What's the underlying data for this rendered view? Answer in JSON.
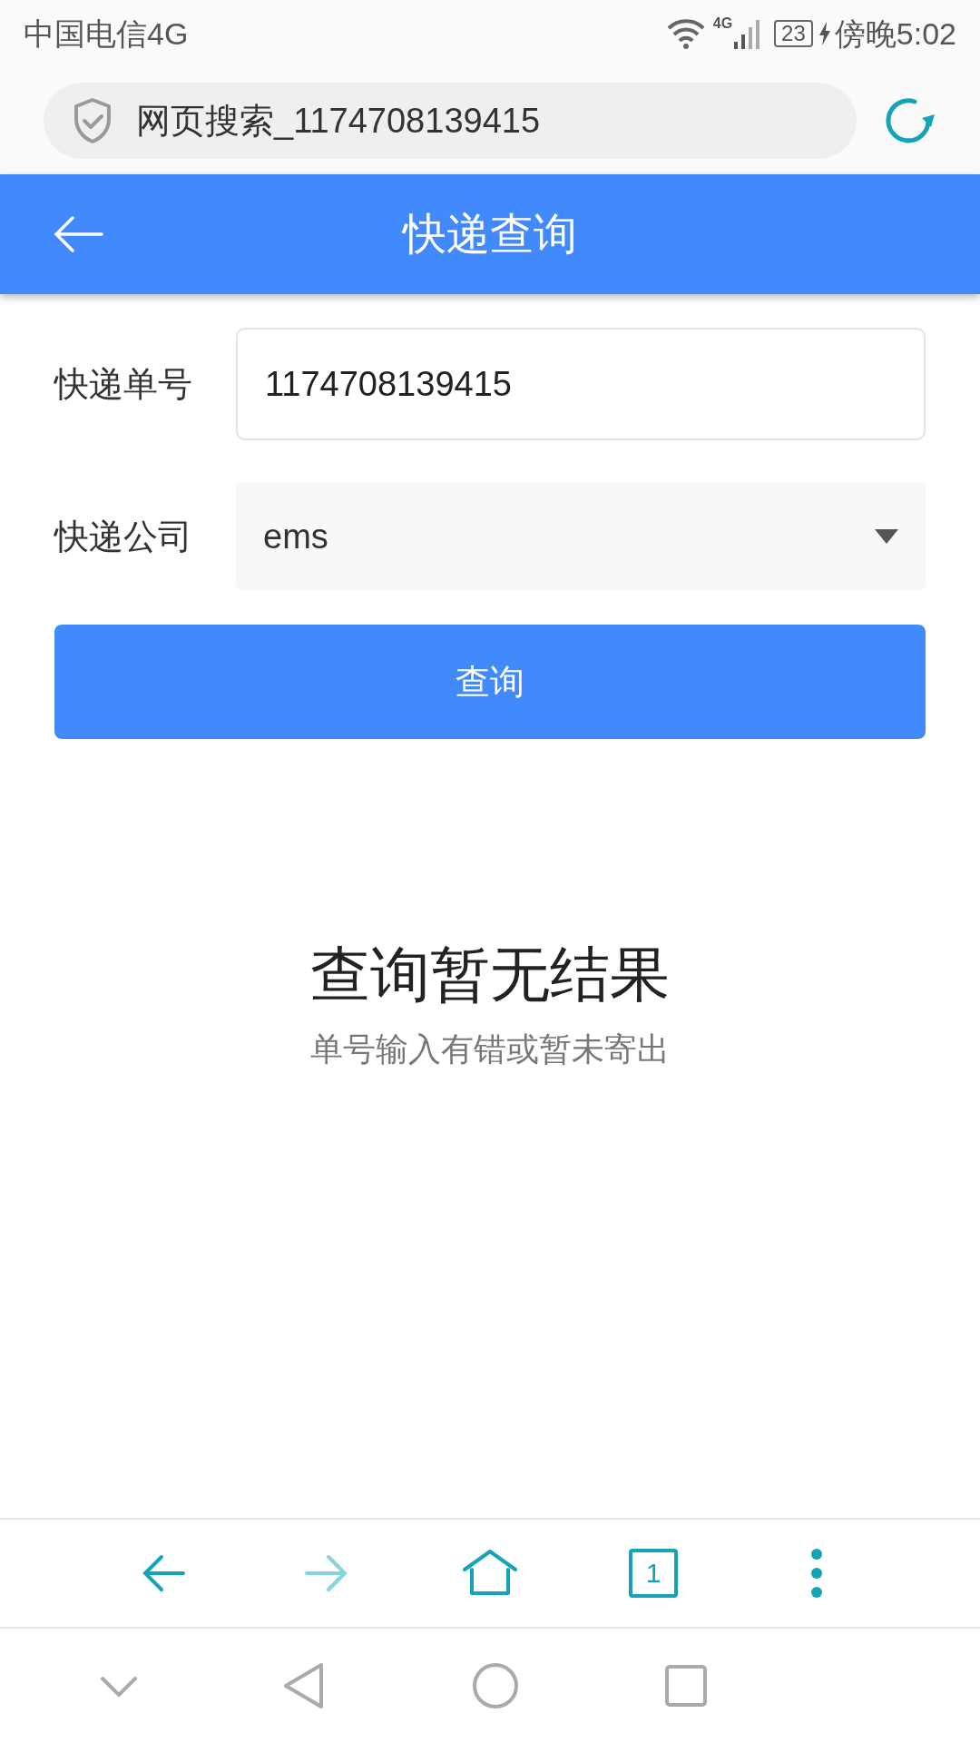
{
  "status_bar": {
    "carrier": "中国电信4G",
    "network": "4G",
    "battery": "23",
    "charging": true,
    "time": "傍晚5:02"
  },
  "address_bar": {
    "text": "网页搜索_1174708139415"
  },
  "header": {
    "title": "快递查询"
  },
  "form": {
    "fields": [
      {
        "kind": "input",
        "label": "快递单号",
        "value": "1174708139415"
      },
      {
        "kind": "select",
        "label": "快递公司",
        "value": "ems"
      }
    ],
    "button": "查询"
  },
  "result": {
    "title": "查询暂无结果",
    "subtitle": "单号输入有错或暂未寄出"
  },
  "toolbar": {
    "items": [
      {
        "kind": "back",
        "disabled": false
      },
      {
        "kind": "forward",
        "disabled": true
      },
      {
        "kind": "home",
        "disabled": false
      },
      {
        "kind": "tabs",
        "count": "1",
        "disabled": false
      },
      {
        "kind": "menu",
        "disabled": false
      }
    ]
  }
}
